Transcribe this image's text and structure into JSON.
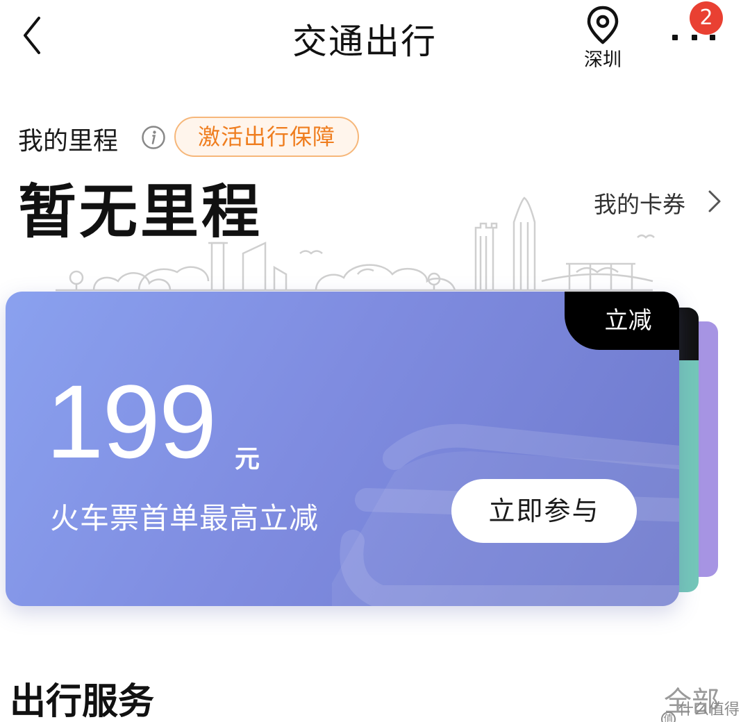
{
  "header": {
    "title": "交通出行",
    "location": "深圳",
    "notification_count": "2"
  },
  "mileage": {
    "label": "我的里程",
    "protection_button": "激活出行保障",
    "value": "暂无里程",
    "coupons_link": "我的卡券"
  },
  "promo_card": {
    "tag": "立减",
    "amount": "199",
    "unit": "元",
    "description": "火车票首单最高立减",
    "button": "立即参与"
  },
  "services": {
    "title": "出行服务",
    "all_link": "全部"
  },
  "watermark": {
    "text": "什么值得买",
    "mark": "值"
  },
  "colors": {
    "accent_orange": "#ef7d1e",
    "badge_red": "#e94032",
    "card_blue": "#7f8ce0",
    "card_green": "#74c7b9",
    "card_purple": "#a694e3"
  }
}
